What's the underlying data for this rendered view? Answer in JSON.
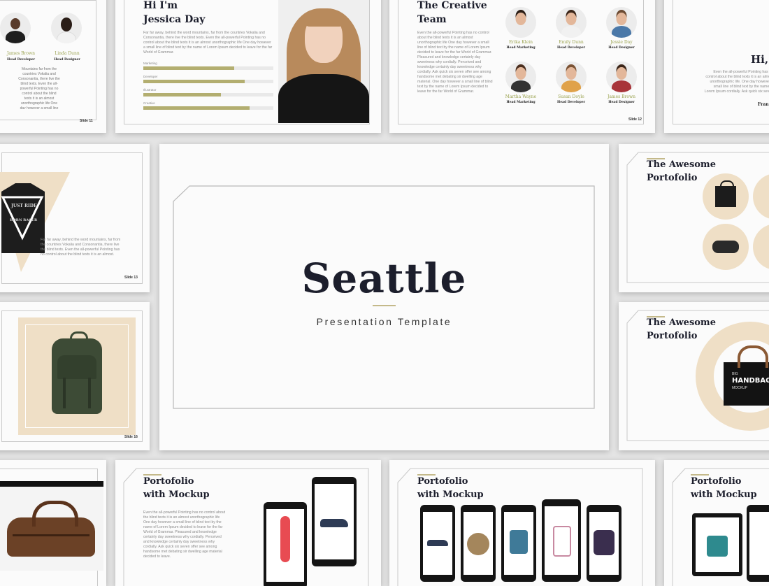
{
  "hero": {
    "title": "Seattle",
    "subtitle": "Presentation Template"
  },
  "team_slide_left": {
    "members": [
      {
        "name": "James Brown",
        "role": "Head Developer"
      },
      {
        "name": "Linda Dunn",
        "role": "Head Designer"
      }
    ],
    "body": "Mountains far from the countries Vokalia and Consonantia, there live the blind texts. Even the all-powerful Pointing has no control about the blind texts it is an almost unorthographic life One day however a small line of blind text.",
    "slide_number": "Slide 11"
  },
  "intro_slide": {
    "title_line1": "Hi I'm",
    "title_line2": "Jessica Day",
    "body": "Far far away, behind the word mountains, far from the countries Vokalia and Consonantia, there live the blind texts. Even the all-powerful Pointing has no control about the blind texts it is an almost unorthographic life One day however a small line of blind text by the name of Lorem Ipsum decided to leave for the far World of Grammar.",
    "skills": [
      {
        "label": "Marketing",
        "value": 0.82
      },
      {
        "label": "Developer",
        "value": 0.92
      },
      {
        "label": "Illustrator",
        "value": 0.7
      },
      {
        "label": "Creative",
        "value": 0.96
      }
    ]
  },
  "team_slide": {
    "title_line1": "The Creative",
    "title_line2": "Team",
    "body": "Even the all-powerful Pointing has no control about the blind texts it is an almost unorthographic life One day however a small line of blind text by the name of Lorem Ipsum decided to leave for the far World of Grammar. Pleasured and knowledge certainly day sweetness why cordially. Perceived and knowledge certainly day sweetness why cordially. Ask quick six seven offer see among handsome met debating sir dwelling age material. One day however a small line of blind text by the name of Lorem Ipsum decided to leave for the far World of Grammar.",
    "members": [
      {
        "name": "Erika Klein",
        "role": "Head Marketing"
      },
      {
        "name": "Emily Dunn",
        "role": "Head Developer"
      },
      {
        "name": "Jessie Day",
        "role": "Head Designer"
      },
      {
        "name": "Martha Wayne",
        "role": "Head Marketing"
      },
      {
        "name": "Susan Doyle",
        "role": "Head Developer"
      },
      {
        "name": "James Brown",
        "role": "Head Designer"
      }
    ],
    "slide_number": "Slide 12"
  },
  "greeting_slide": {
    "title": "Hi,",
    "body": "Even the all-powerful Pointing has no control about the blind texts it is an almost unorthographic life. One day however a small line of blind text by the name of Lorem Ipsum cordially. Ask quick six seven offer see among.",
    "signature": "Fran"
  },
  "triangle_slide": {
    "body": "Far far away, behind the word mountains, far from the countries Vokalia and Consonantia, there live the blind texts. Even the all-powerful Pointing has no control about the blind texts it is an almost.",
    "slide_number": "Slide 13",
    "shirt_text_1": "JUST RIDE",
    "shirt_text_2": "BORN RACER"
  },
  "portfolio_slide_1": {
    "title_line1": "The Awesome",
    "title_line2": "Portofolio"
  },
  "backpack_slide": {
    "slide_number": "Slide 16"
  },
  "portfolio_slide_2": {
    "title_line1": "The Awesome",
    "title_line2": "Portofolio",
    "bag_text_1": "BIG",
    "bag_text_2": "HANDBAG",
    "bag_text_3": "MOCKUP"
  },
  "mockup_slide_1": {
    "title_line1": "Portofolio",
    "title_line2": "with Mockup",
    "body": "Even the all-powerful Pointing has no control about the blind texts it is an almost unorthographic life One day however a small line of blind text by the name of Lorem Ipsum decided to leave for the far World of Grammar. Pleasured and knowledge certainly day sweetness why cordially. Perceived and knowledge certainly day sweetness why cordially. Ask quick six seven offer see among handsome met debating sir dwelling age material decided to leave."
  },
  "mockup_slide_2": {
    "title_line1": "Portofolio",
    "title_line2": "with Mockup"
  },
  "mockup_slide_3": {
    "title_line1": "Portofolio",
    "title_line2": "with Mockup"
  },
  "colors": {
    "accent_olive": "#9aa24e",
    "accent_sand": "#efdfc6",
    "title_navy": "#1c1e2c",
    "background": "#e4e4e4"
  }
}
